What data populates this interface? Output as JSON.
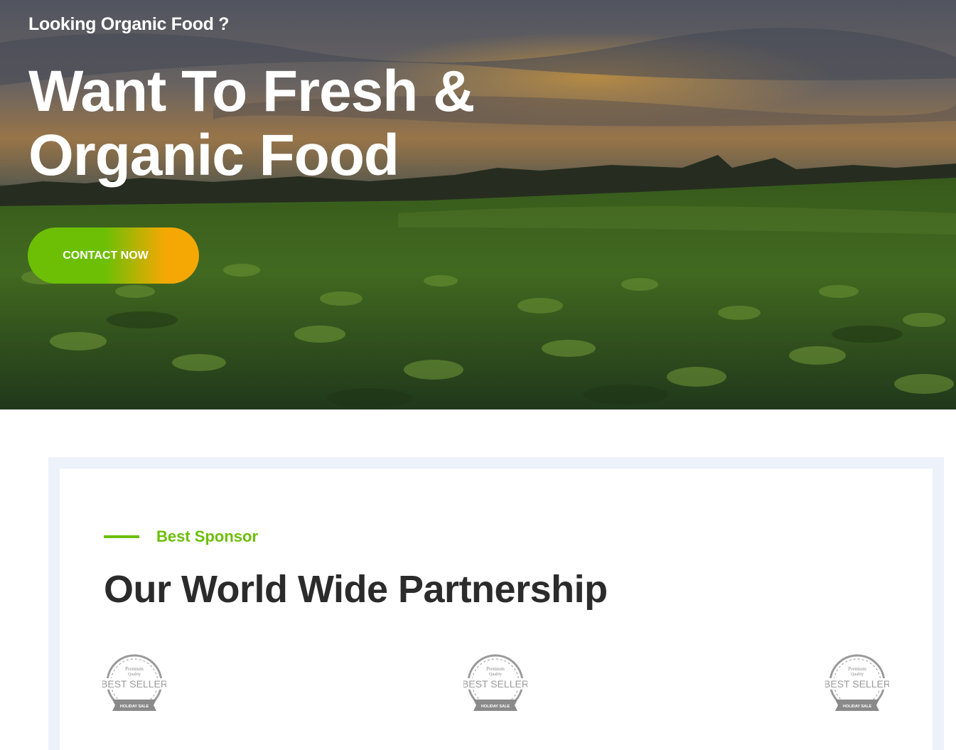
{
  "hero": {
    "kicker": "Looking Organic Food ?",
    "headline": "Want To Fresh & Organic Food",
    "cta_label": "CONTACT NOW"
  },
  "partners": {
    "subtitle": "Best Sponsor",
    "title": "Our World Wide Partnership",
    "logos": [
      {
        "top": "Premium",
        "mid": "Quality",
        "main": "BEST SELLER",
        "ribbon": "HOLIDAY SALE"
      },
      {
        "top": "Premium",
        "mid": "Quality",
        "main": "BEST SELLER",
        "ribbon": "HOLIDAY SALE"
      },
      {
        "top": "Premium",
        "mid": "Quality",
        "main": "BEST SELLER",
        "ribbon": "HOLIDAY SALE"
      }
    ]
  },
  "colors": {
    "accent_green": "#6cbf05",
    "accent_orange": "#f5a804",
    "heading_dark": "#2b2b2b",
    "frame_bg": "#edf1fa"
  },
  "icons": [
    "best-seller-badge-icon"
  ]
}
